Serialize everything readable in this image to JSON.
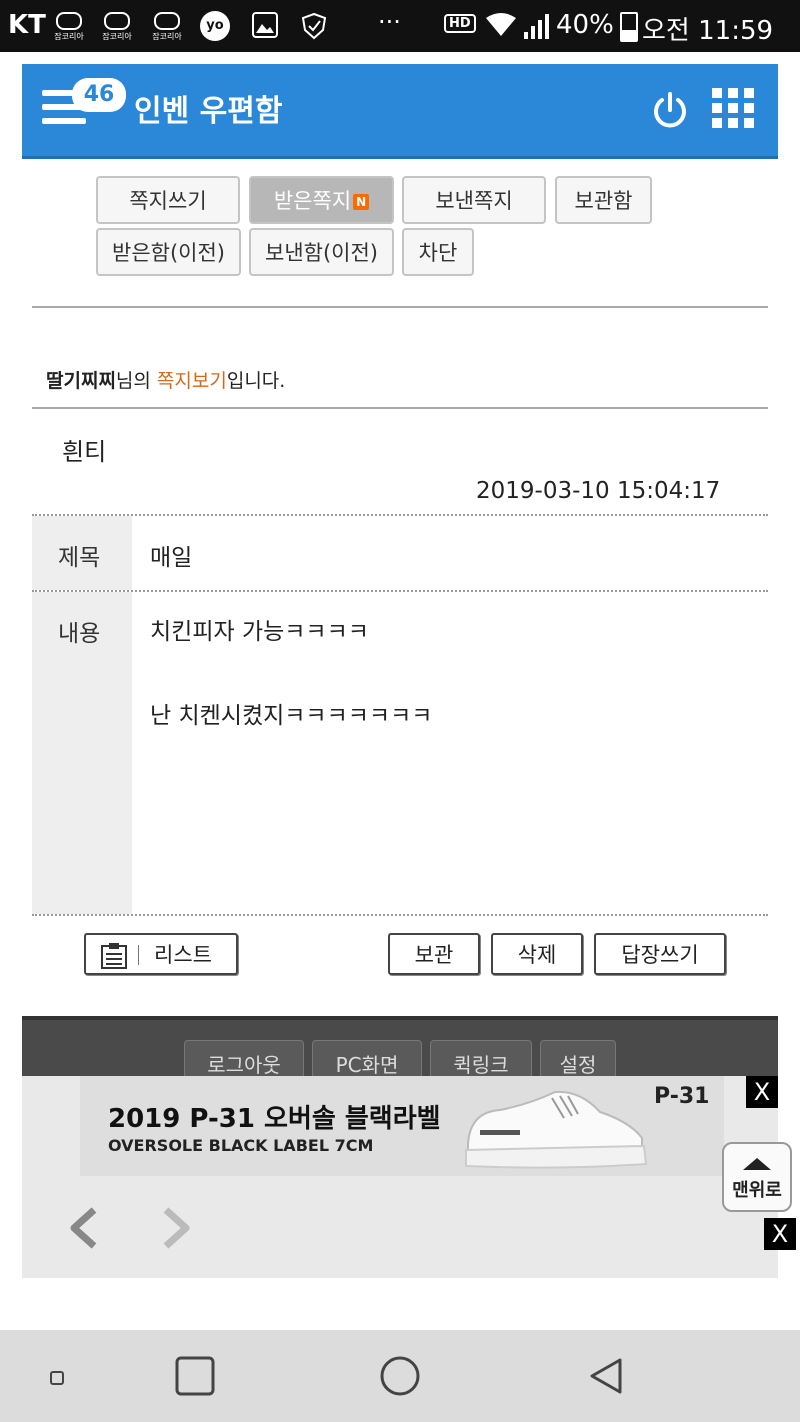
{
  "status_bar": {
    "carrier": "KT",
    "mini_labels": [
      "잡코리아",
      "잡코리아",
      "잡코리아"
    ],
    "yo_label": "yo",
    "more": "···",
    "hd": "HD",
    "battery": "40%",
    "time": "오전 11:59"
  },
  "header": {
    "badge_count": "46",
    "title": "인벤 우편함"
  },
  "tabs": {
    "write": "쪽지쓰기",
    "received": "받은쪽지",
    "received_new": "N",
    "sent": "보낸쪽지",
    "archive": "보관함",
    "received_old": "받은함(이전)",
    "sent_old": "보낸함(이전)",
    "block": "차단"
  },
  "notice": {
    "sender": "딸기찌찌",
    "middle": "님의 ",
    "highlight": "쪽지보기",
    "end": "입니다."
  },
  "message": {
    "from": "흰티",
    "date": "2019-03-10 15:04:17",
    "subject_label": "제목",
    "subject": "매일",
    "content_label": "내용",
    "content_line1": "치킨피자 가능ㅋㅋㅋㅋ",
    "content_line2": "난 치켄시켰지ㅋㅋㅋㅋㅋㅋㅋ"
  },
  "actions": {
    "list": "리스트",
    "keep": "보관",
    "delete": "삭제",
    "reply": "답장쓰기"
  },
  "footer": {
    "logout": "로그아웃",
    "pc": "PC화면",
    "quicklink": "퀵링크",
    "settings": "설정"
  },
  "ad": {
    "title": "2019 P-31 오버솔 블랙라벨",
    "subtitle": "OVERSOLE BLACK LABEL 7CM",
    "brand": "P-31",
    "close": "X"
  },
  "back_to_top": "맨위로",
  "colors": {
    "header_blue": "#2b88d8",
    "highlight_orange": "#d2691e",
    "new_badge": "#ff6a00"
  }
}
